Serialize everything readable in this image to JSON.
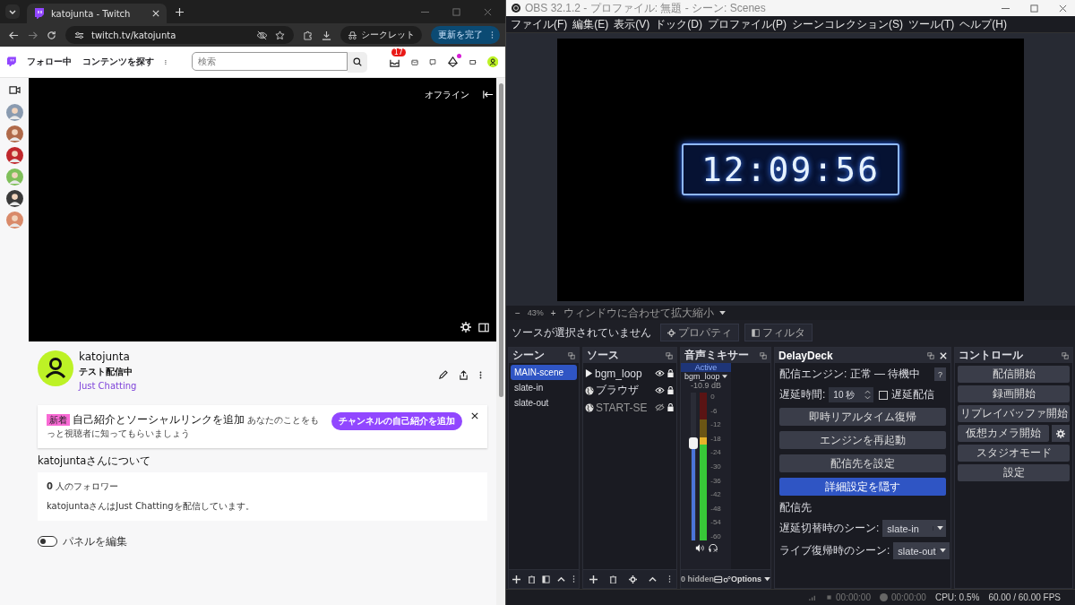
{
  "browser": {
    "tab_title": "katojunta - Twitch",
    "url": "twitch.tv/katojunta",
    "incognito_label": "シークレット",
    "update_button": "更新を完了"
  },
  "twitch": {
    "nav": [
      "フォロー中",
      "コンテンツを探す"
    ],
    "search": {
      "placeholder": "検索"
    },
    "notification_count": "17",
    "sidebar": [
      {
        "kind": "avatar"
      },
      {
        "kind": "avatar"
      },
      {
        "kind": "avatar"
      },
      {
        "kind": "avatar"
      },
      {
        "kind": "avatar"
      },
      {
        "kind": "avatar"
      }
    ],
    "player": {
      "status": "オフライン"
    },
    "channel": {
      "name": "katojunta",
      "title": "テスト配信中",
      "category": "Just Chatting"
    },
    "promo": {
      "badge": "新着",
      "headline": "自己紹介とソーシャルリンクを追加",
      "body": "あなたのことをもっと視聴者に知ってもらいましょう",
      "button": "チャンネルの自己紹介を追加"
    },
    "about": {
      "heading": "katojuntaさんについて",
      "followers_count": "0",
      "followers_label": "人のフォロワー",
      "description": "katojuntaさんはJust Chattingを配信しています。"
    },
    "edit_panels": {
      "label": "パネルを編集",
      "on": false
    }
  },
  "obs": {
    "title": "OBS 32.1.2 - プロファイル: 無題 - シーン: Scenes",
    "menu": [
      "ファイル(F)",
      "編集(E)",
      "表示(V)",
      "ドック(D)",
      "プロファイル(P)",
      "シーンコレクション(S)",
      "ツール(T)",
      "ヘルプ(H)"
    ],
    "preview": {
      "clock": "12:09:56",
      "zoom_out": "−",
      "zoom": "43%",
      "zoom_in": "+",
      "fit_label": "ウィンドウに合わせて拡大縮小"
    },
    "source_status": "ソースが選択されていません",
    "source_buttons": [
      "プロパティ",
      "フィルタ"
    ],
    "scenes": {
      "title": "シーン",
      "items": [
        {
          "name": "MAIN-scene",
          "selected": true
        },
        {
          "name": "slate-in",
          "selected": false
        },
        {
          "name": "slate-out",
          "selected": false
        }
      ]
    },
    "sources": {
      "title": "ソース",
      "items": [
        {
          "name": "bgm_loop",
          "kind": "media",
          "visible": true
        },
        {
          "name": "ブラウザ",
          "kind": "browser",
          "visible": true
        },
        {
          "name": "START-SE",
          "kind": "browser",
          "visible": false
        }
      ]
    },
    "mixer": {
      "title": "音声ミキサー",
      "badge": "Active",
      "channel": "bgm_loop",
      "reading": "-10.9 dB",
      "fader": {
        "level": 0.66
      },
      "meter": {
        "level": 0.7
      },
      "ticks": [
        "0",
        "-6",
        "-12",
        "-18",
        "-24",
        "-30",
        "-36",
        "-42",
        "-48",
        "-54",
        "-60"
      ],
      "hidden_label": "0 hidden",
      "options_label": "Options"
    },
    "delaydeck": {
      "title": "DelayDeck",
      "status": "配信エンジン: 正常 — 待機中",
      "help": "?",
      "delay_label": "遅延時間:",
      "delay_value": "10 秒",
      "delay_check": {
        "label": "遅延配信",
        "checked": false
      },
      "buttons": [
        {
          "label": "即時リアルタイム復帰",
          "kind": "normal"
        },
        {
          "label": "エンジンを再起動",
          "kind": "normal"
        },
        {
          "label": "配信先を設定",
          "kind": "normal"
        },
        {
          "label": "詳細設定を隠す",
          "kind": "primary"
        }
      ],
      "section": "配信先",
      "selects": [
        {
          "label": "遅延切替時のシーン:",
          "value": "slate-in"
        },
        {
          "label": "ライブ復帰時のシーン:",
          "value": "slate-out"
        }
      ]
    },
    "controls": {
      "title": "コントロール",
      "buttons": [
        {
          "label": "配信開始",
          "kind": "plain"
        },
        {
          "label": "録画開始",
          "kind": "plain"
        },
        {
          "label": "リプレイバッファ開始",
          "kind": "plain"
        },
        {
          "label": "仮想カメラ開始",
          "kind": "with_settings"
        },
        {
          "label": "スタジオモード",
          "kind": "plain"
        },
        {
          "label": "設定",
          "kind": "plain"
        }
      ]
    },
    "status_bar": {
      "stream_time": "00:00:00",
      "record_time": "00:00:00",
      "cpu": "CPU: 0.5%",
      "fps": "60.00 / 60.00 FPS"
    }
  }
}
